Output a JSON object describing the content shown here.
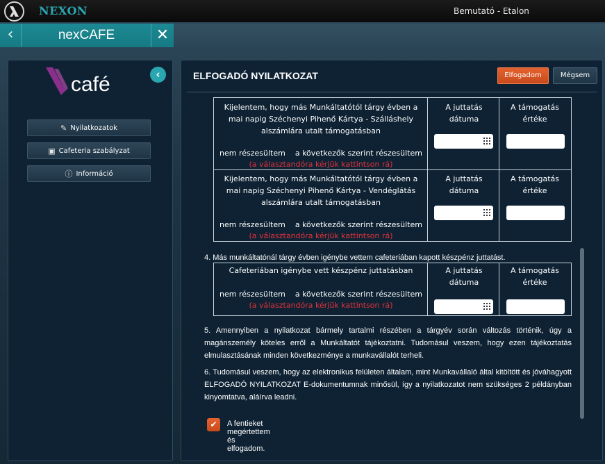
{
  "topbar": {
    "brand": "NEXON",
    "user": "Bemutató - Etalon"
  },
  "appbar": {
    "back_glyph": "‹",
    "title": "nexCAFE",
    "close_glyph": "✕"
  },
  "sidebar": {
    "logo_text": "café",
    "collapse_glyph": "‹",
    "items": [
      {
        "label": "Nyilatkozatok",
        "icon": "edit-icon"
      },
      {
        "label": "Cafeteria szabályzat",
        "icon": "book-icon"
      },
      {
        "label": "Információ",
        "icon": "info-icon"
      }
    ]
  },
  "main": {
    "title": "ELFOGADÓ NYILATKOZAT",
    "accept_label": "Elfogadom",
    "cancel_label": "Mégsem",
    "block1": {
      "text": "Kijelentem, hogy más Munkáltatótól tárgy évben a mai napig Széchenyi Pihenő Kártya - Szálláshely alszámlára utalt támogatásban",
      "option_no": "nem részesültem",
      "option_yes": "a következők szerint részesültem",
      "hint": "(a választandóra kérjük kattintson rá)",
      "date_header": "A juttatás dátuma",
      "value_header": "A támogatás értéke"
    },
    "block2": {
      "text": "Kijelentem, hogy más Munkáltatótól tárgy évben a mai napig Széchenyi Pihenő Kártya - Vendéglátás alszámlára utalt támogatásban",
      "option_no": "nem részesültem",
      "option_yes": "a következők szerint részesültem",
      "hint": "(a választandóra kérjük kattintson rá)",
      "date_header": "A juttatás dátuma",
      "value_header": "A támogatás értéke"
    },
    "item4": {
      "number": "4.",
      "text": "Más munkáltatónál tárgy évben igénybe vettem cafeteriában kapott készpénz juttatást.",
      "box_text": "Cafeteriában igénybe vett készpénz juttatásban",
      "option_no": "nem részesültem",
      "option_yes": "a következők szerint részesültem",
      "hint": "(a választandóra kérjük kattintson rá)",
      "date_header": "A juttatás dátuma",
      "value_header": "A támogatás értéke"
    },
    "item5": {
      "number": "5.",
      "text": "Amennyiben a nyilatkozat bármely tartalmi részében a tárgyév során változás történik, úgy a magánszemély köteles erről a Munkáltatót tájékoztatni. Tudomásul veszem, hogy ezen tájékoztatás elmulasztásának minden következménye a munkavállalót terheli."
    },
    "item6": {
      "number": "6.",
      "text": "Tudomásul veszem, hogy az elektronikus felületen általam, mint Munkavállaló által kitöltött és jóváhagyott ELFOGADÓ NYILATKOZAT E-dokumentumnak minősül, így a nyilatkozatot nem szükséges 2 példányban kinyomtatva, aláírva leadni."
    },
    "accept_check_label": "A fentieket megértettem és elfogadom.",
    "accent_color": "#e4622e",
    "teal_color": "#1d8a93"
  }
}
